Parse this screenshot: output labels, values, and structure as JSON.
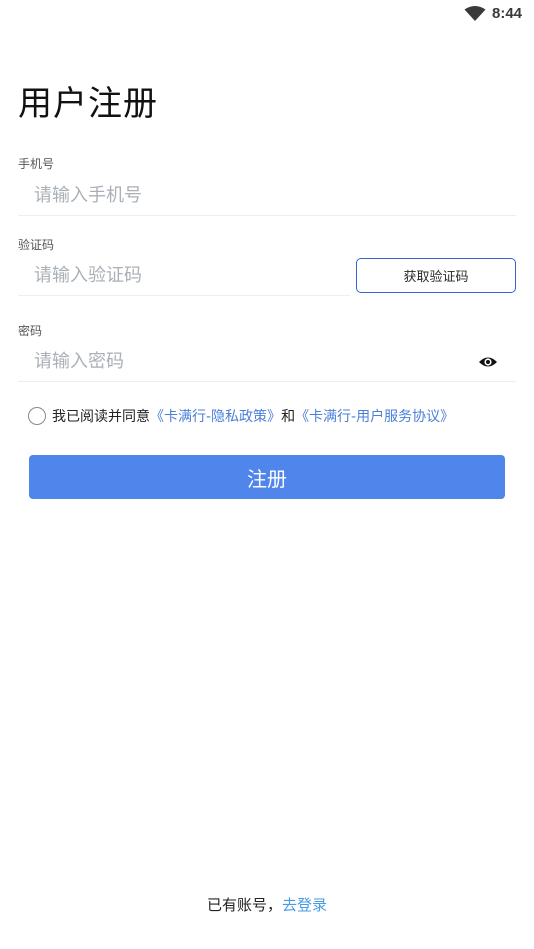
{
  "status_bar": {
    "time": "8:44"
  },
  "title": "用户注册",
  "phone": {
    "label": "手机号",
    "placeholder": "请输入手机号",
    "value": ""
  },
  "code": {
    "label": "验证码",
    "placeholder": "请输入验证码",
    "value": "",
    "button_label": "获取验证码"
  },
  "password": {
    "label": "密码",
    "placeholder": "请输入密码",
    "value": "",
    "toggle_icon": "eye-icon"
  },
  "agreement": {
    "checked": false,
    "prefix": "我已阅读并同意",
    "privacy_link": "《卡满行-隐私政策》",
    "conjunction": "和",
    "service_link": "《卡满行-用户服务协议》"
  },
  "register_button": "注册",
  "footer": {
    "text": "已有账号，",
    "login_link": "去登录"
  },
  "colors": {
    "primary": "#5086eb",
    "link": "#4a7fd8",
    "footer_link": "#4a9be6",
    "code_button_border": "#3366cc"
  }
}
